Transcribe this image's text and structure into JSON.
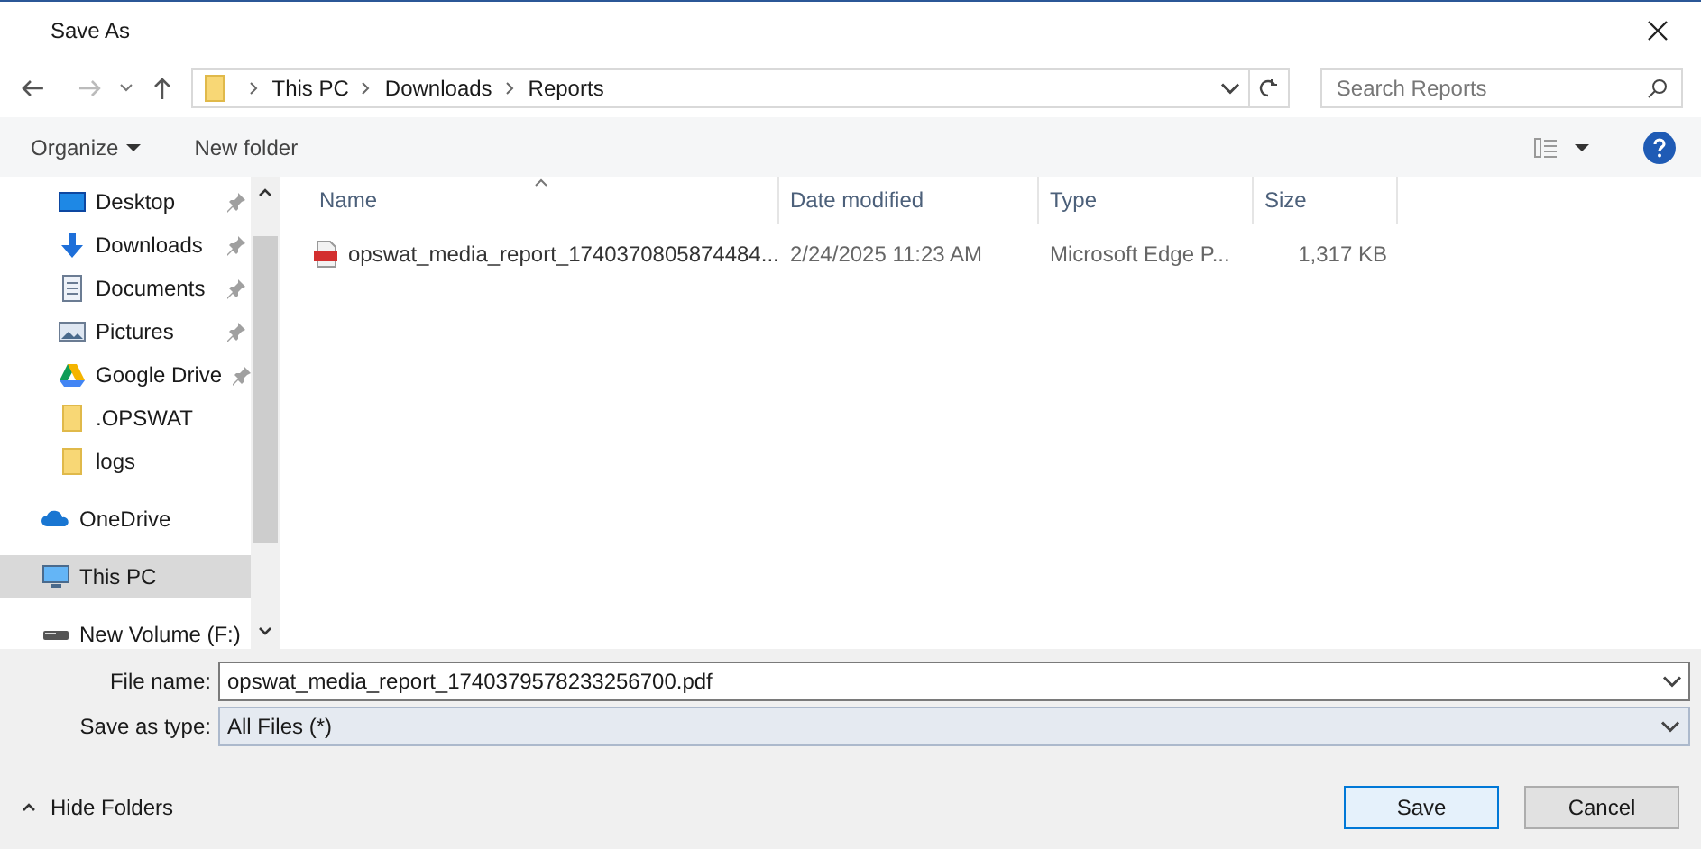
{
  "window": {
    "title": "Save As"
  },
  "address": {
    "path": [
      "This PC",
      "Downloads",
      "Reports"
    ]
  },
  "search": {
    "placeholder": "Search Reports"
  },
  "toolbar": {
    "organize": "Organize",
    "new_folder": "New folder"
  },
  "sidebar": {
    "items": [
      {
        "label": "Desktop",
        "kind": "desktop",
        "pinned": true,
        "selected": false
      },
      {
        "label": "Downloads",
        "kind": "download",
        "pinned": true,
        "selected": false
      },
      {
        "label": "Documents",
        "kind": "document",
        "pinned": true,
        "selected": false
      },
      {
        "label": "Pictures",
        "kind": "pictures",
        "pinned": true,
        "selected": false
      },
      {
        "label": "Google Drive",
        "kind": "drive",
        "pinned": true,
        "selected": false
      },
      {
        "label": ".OPSWAT",
        "kind": "folder",
        "pinned": false,
        "selected": false
      },
      {
        "label": "logs",
        "kind": "folder",
        "pinned": false,
        "selected": false
      },
      {
        "label": "OneDrive",
        "kind": "cloud",
        "pinned": false,
        "selected": false
      },
      {
        "label": "This PC",
        "kind": "pc",
        "pinned": false,
        "selected": true
      },
      {
        "label": "New Volume (F:)",
        "kind": "disk",
        "pinned": false,
        "selected": false
      }
    ]
  },
  "table": {
    "columns": [
      "Name",
      "Date modified",
      "Type",
      "Size"
    ],
    "rows": [
      {
        "name": "opswat_media_report_1740370805874484...",
        "date": "2/24/2025 11:23 AM",
        "type": "Microsoft Edge P...",
        "size": "1,317 KB"
      }
    ]
  },
  "form": {
    "file_name_label": "File name:",
    "file_name": "opswat_media_report_1740379578233256700.pdf",
    "type_label": "Save as type:",
    "type_value": "All Files (*)"
  },
  "footer": {
    "hide_folders": "Hide Folders",
    "buttons": [
      "Save",
      "Cancel"
    ]
  }
}
